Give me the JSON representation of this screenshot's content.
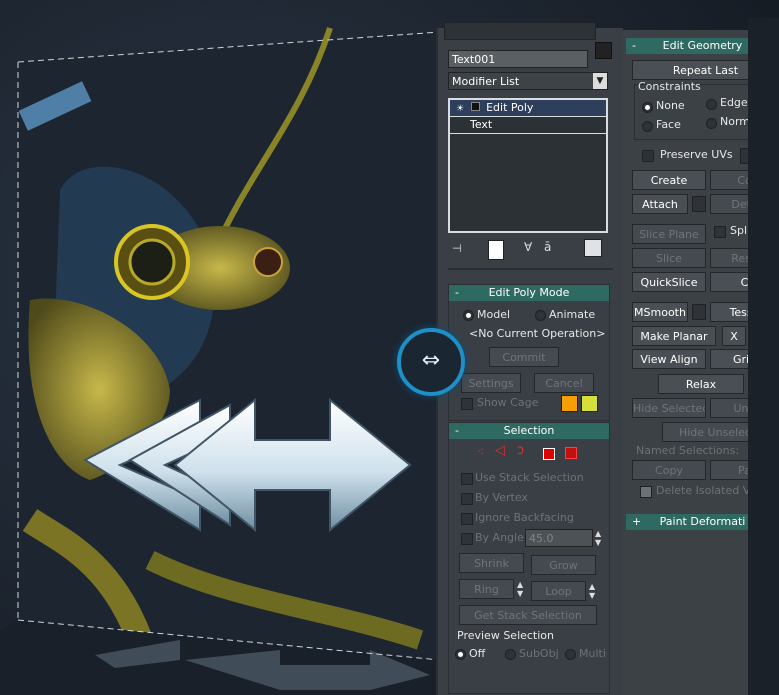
{
  "top_panel": {
    "object_name": "Text001",
    "modifier_list": "Modifier List",
    "stack": [
      "Edit Poly",
      "Text"
    ]
  },
  "edit_poly_mode": {
    "title": "Edit Poly Mode",
    "model": "Model",
    "animate": "Animate",
    "operation": "<No Current Operation>",
    "commit": "Commit",
    "settings": "Settings",
    "cancel": "Cancel",
    "show_cage": "Show Cage",
    "cage_colors": [
      "#f5a000",
      "#d6e03a"
    ]
  },
  "selection": {
    "title": "Selection",
    "use_stack": "Use Stack Selection",
    "by_vertex": "By Vertex",
    "ignore_backfacing": "Ignore Backfacing",
    "by_angle": "By Angle:",
    "angle_value": "45.0",
    "shrink": "Shrink",
    "grow": "Grow",
    "ring": "Ring",
    "loop": "Loop",
    "get_stack": "Get Stack Selection",
    "preview": "Preview Selection",
    "off": "Off",
    "subobj": "SubObj",
    "multi": "Multi"
  },
  "edit_geometry": {
    "title": "Edit Geometry",
    "repeat_last": "Repeat Last",
    "constraints": "Constraints",
    "none": "None",
    "edge": "Edge",
    "face": "Face",
    "normal": "Norm",
    "preserve_uvs": "Preserve UVs",
    "create": "Create",
    "collapse": "Co",
    "attach": "Attach",
    "detach": "Deta",
    "slice_plane": "Slice Plane",
    "split": "Spl",
    "slice": "Slice",
    "reset": "Rese",
    "quickslice": "QuickSlice",
    "cut": "C",
    "msmooth": "MSmooth",
    "tessellate": "Tesse",
    "make_planar": "Make Planar",
    "x": "X",
    "view_align": "View Align",
    "grid": "Grid",
    "relax": "Relax",
    "hide_selected": "Hide Selected",
    "unhide": "Unh",
    "hide_unselected": "Hide Unselecte",
    "named_selections": "Named Selections:",
    "copy": "Copy",
    "paste": "Pa",
    "delete_isolated": "Delete Isolated Ve"
  },
  "paint_deformation": {
    "title": "Paint Deformati"
  }
}
